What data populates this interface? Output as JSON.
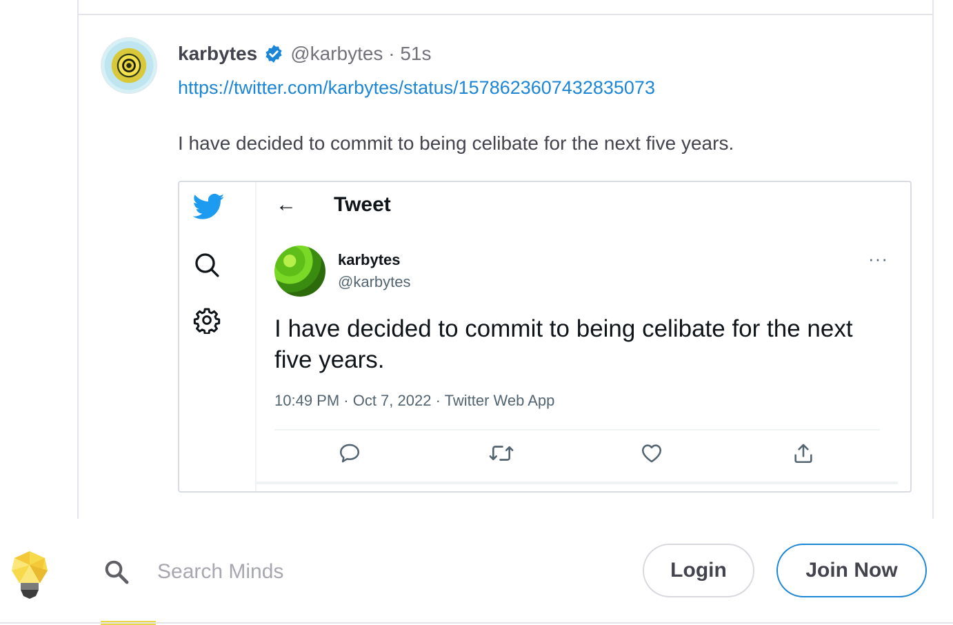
{
  "post": {
    "author_name": "karbytes",
    "handle_time": "@karbytes · 51s",
    "link": "https://twitter.com/karbytes/status/1578623607432835073",
    "text": "I have decided to commit to being celibate for the next five years."
  },
  "embed": {
    "header_title": "Tweet",
    "back_glyph": "←",
    "author_name": "karbytes",
    "author_handle": "@karbytes",
    "more_glyph": "···",
    "text": "I have decided to commit to being celibate for the next five years.",
    "meta": "10:49 PM · Oct 7, 2022 · Twitter Web App",
    "sidebar_icons": [
      "twitter-bird-icon",
      "search-icon",
      "settings-gear-icon"
    ],
    "action_icons": [
      "reply-icon",
      "retweet-icon",
      "like-icon",
      "share-icon"
    ]
  },
  "bottom_bar": {
    "search_placeholder": "Search Minds",
    "login_label": "Login",
    "join_label": "Join Now"
  },
  "colors": {
    "link": "#1b85d6",
    "verified": "#1b85d6",
    "twitter_blue": "#1d9bf0",
    "text": "#43434d"
  }
}
